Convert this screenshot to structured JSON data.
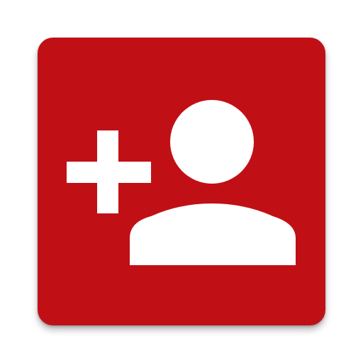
{
  "app_icon": {
    "name": "add-contact",
    "background_color": "#c01016",
    "glyph_color": "#ffffff",
    "icons": [
      "plus-icon",
      "person-icon"
    ]
  }
}
